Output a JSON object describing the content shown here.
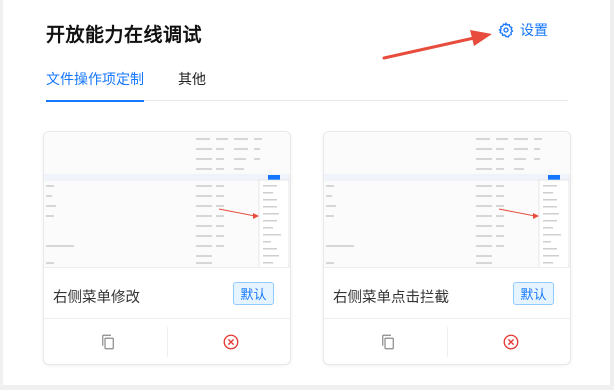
{
  "header": {
    "title": "开放能力在线调试",
    "settings_label": "设置",
    "settings_icon": "gear-icon"
  },
  "tabs": [
    {
      "label": "文件操作项定制",
      "active": true
    },
    {
      "label": "其他",
      "active": false
    }
  ],
  "cards": [
    {
      "name": "右侧菜单修改",
      "badge": "默认",
      "copy_icon": "copy-icon",
      "delete_icon": "close-circle-icon"
    },
    {
      "name": "右侧菜单点击拦截",
      "badge": "默认",
      "copy_icon": "copy-icon",
      "delete_icon": "close-circle-icon"
    }
  ],
  "colors": {
    "accent": "#1677ff",
    "annotation_arrow": "#e74c3c",
    "delete": "#e53935"
  }
}
